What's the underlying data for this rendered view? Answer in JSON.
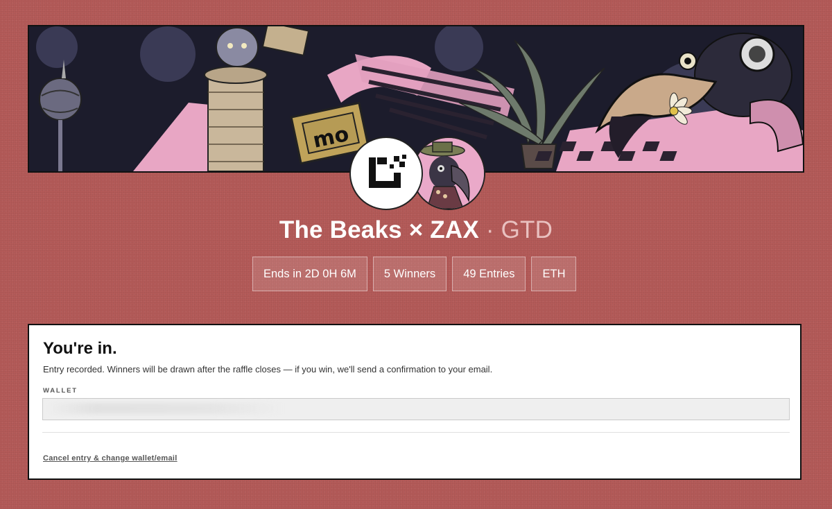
{
  "raffle": {
    "title": "The Beaks × ZAX",
    "separator": "·",
    "tag": "GTD"
  },
  "stats": [
    {
      "label": "Ends in 2D 0H 6M"
    },
    {
      "label": "5 Winners"
    },
    {
      "label": "49 Entries"
    },
    {
      "label": "ETH"
    }
  ],
  "entry": {
    "heading": "You're in.",
    "message": "Entry recorded. Winners will be drawn after the raffle closes — if you win, we'll send a confirmation to your email.",
    "wallet_label": "WALLET",
    "wallet_value": "",
    "cancel_link": "Cancel entry & change wallet/email"
  },
  "colors": {
    "background": "#b45a58",
    "card": "#ffffff",
    "banner_pink": "#e8a6c4",
    "banner_dark": "#1b1b2a"
  },
  "icons": {
    "logo": "zax-logo-icon",
    "avatar": "beaks-avatar-icon"
  }
}
